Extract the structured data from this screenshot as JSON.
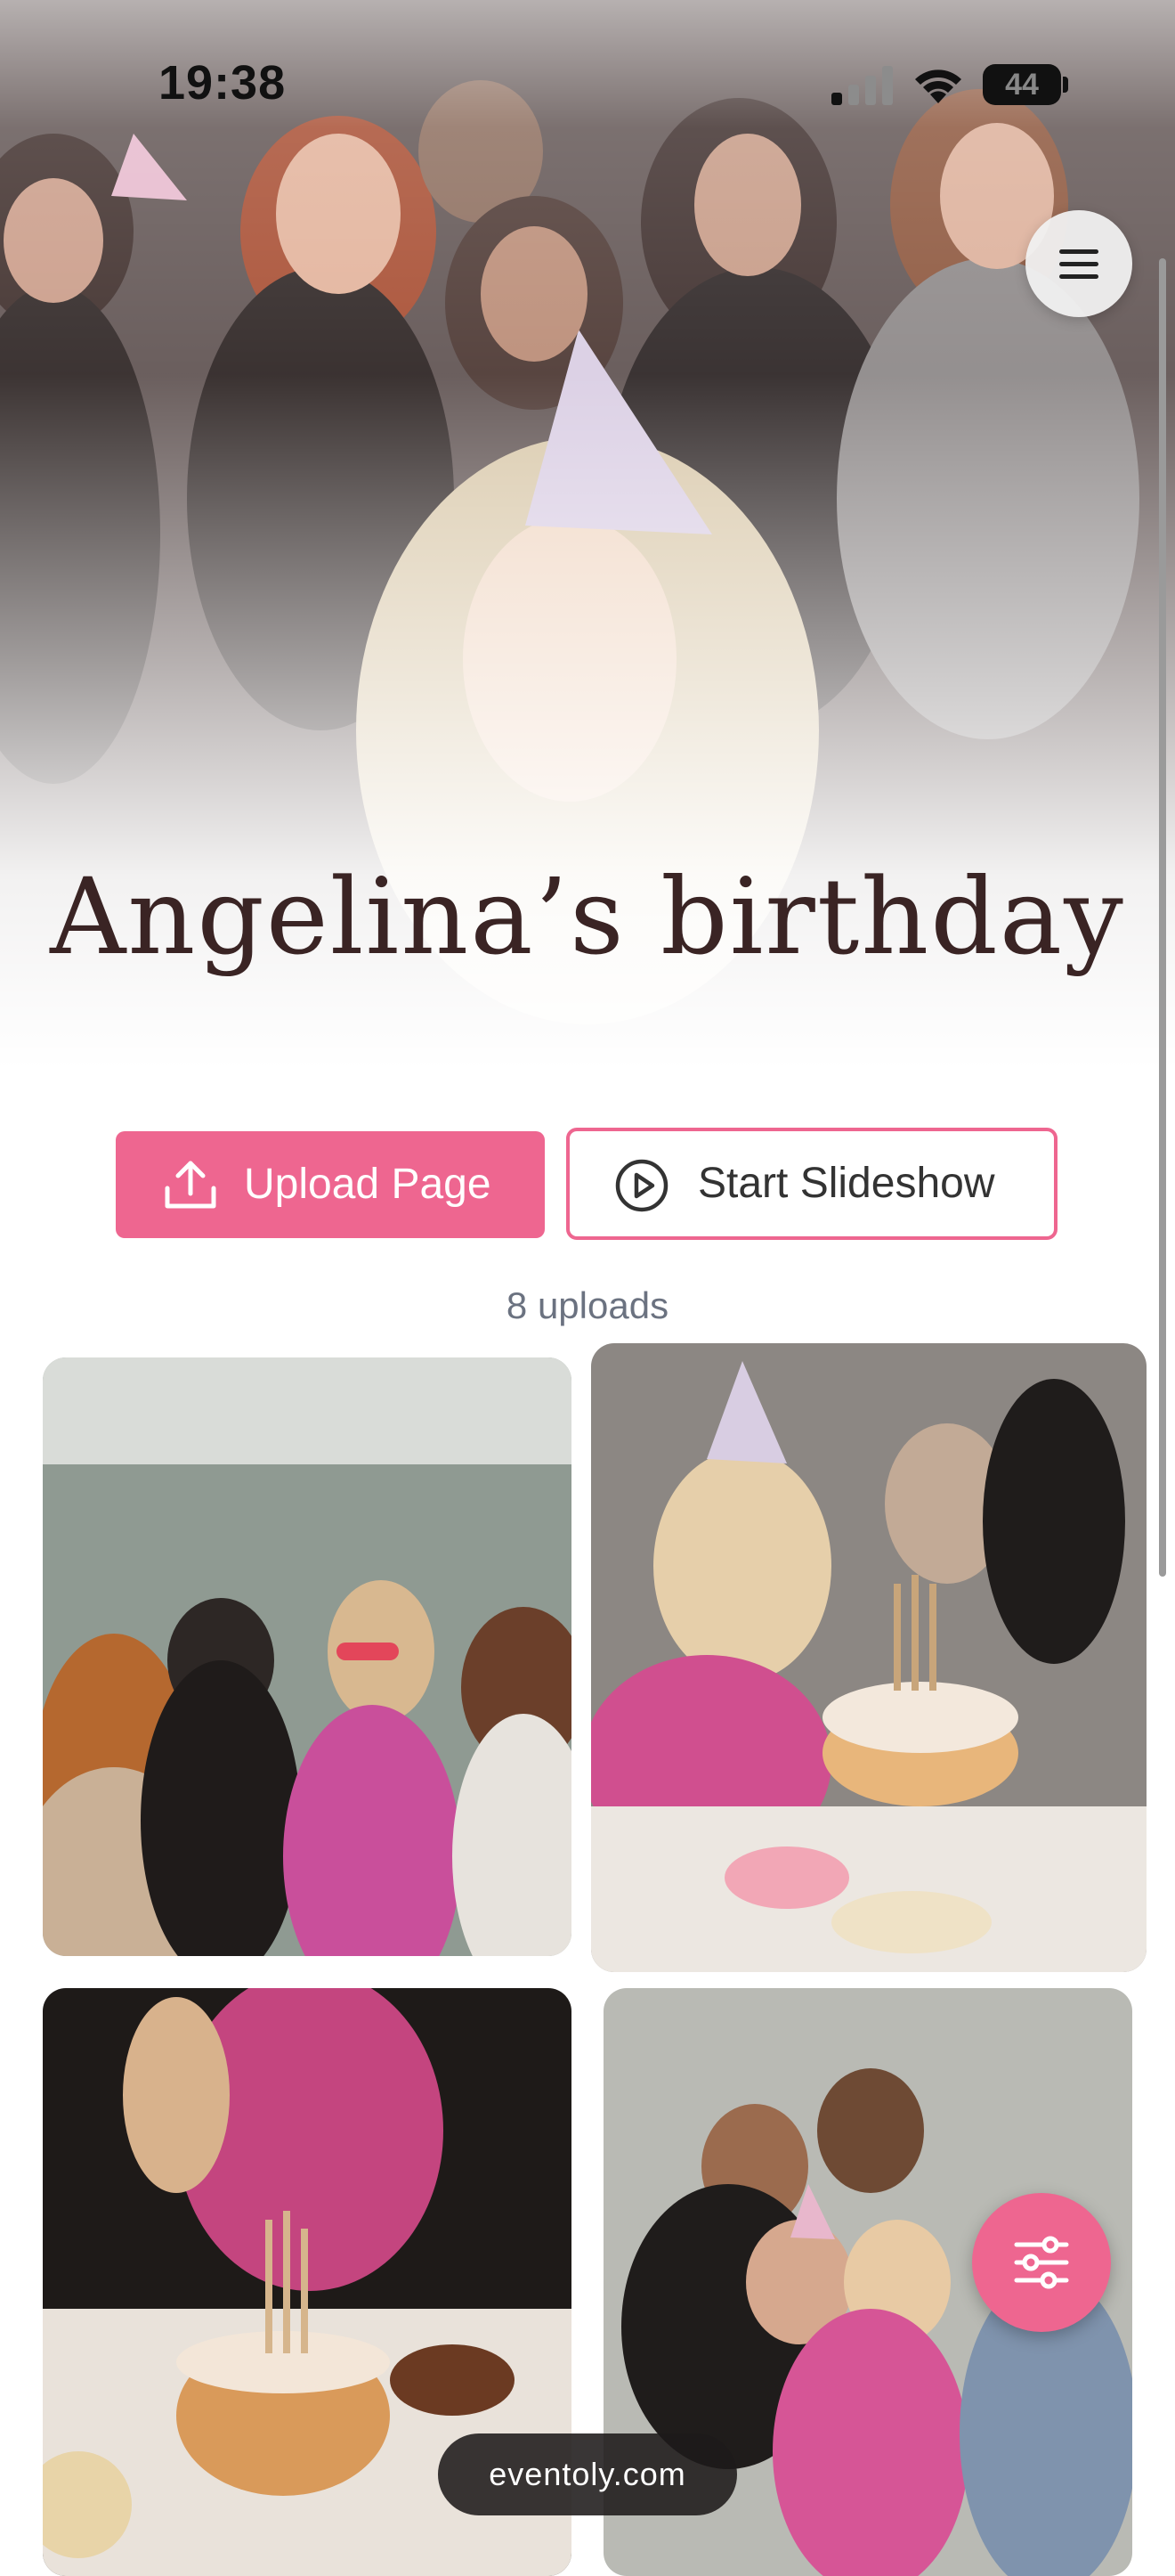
{
  "status_bar": {
    "time": "19:38",
    "battery": "44"
  },
  "event": {
    "title": "Angelina’s birthday"
  },
  "actions": {
    "upload_label": "Upload Page",
    "slideshow_label": "Start Slideshow"
  },
  "gallery": {
    "uploads_count": "8 uploads"
  },
  "footer": {
    "domain": "eventoly.com"
  },
  "colors": {
    "accent": "#ee6690",
    "title": "#3a2424"
  },
  "icons": [
    "menu-icon",
    "upload-icon",
    "play-circle-icon",
    "filter-sliders-icon",
    "wifi-icon",
    "cell-signal-icon",
    "battery-icon"
  ]
}
